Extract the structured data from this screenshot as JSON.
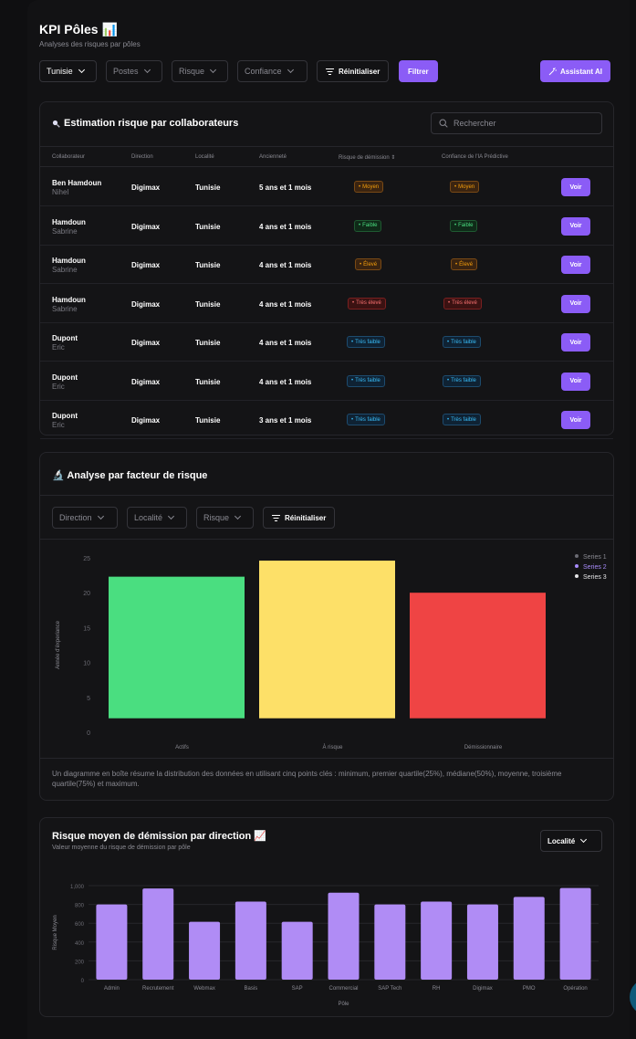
{
  "header": {
    "title": "KPI Pôles 📊",
    "subtitle": "Analyses des risques par pôles"
  },
  "filters": {
    "country": "Tunisie",
    "postes": "Postes",
    "risque": "Risque",
    "confiance": "Confiance",
    "reset": "Réinitialiser",
    "filter": "Filtrer",
    "assistant": "Assistant AI"
  },
  "estimation": {
    "title": "Estimation risque par collaborateurs",
    "search_placeholder": "Rechercher",
    "columns": [
      "Collaborateur",
      "Direction",
      "Localité",
      "Ancienneté",
      "Risque de démission ⇕",
      "Confiance de l'IA Prédictive"
    ],
    "action_label": "Voir",
    "rows": [
      {
        "last": "Ben Hamdoun",
        "first": "Nihel",
        "direction": "Digimax",
        "locality": "Tunisie",
        "seniority": "5 ans et 1 mois",
        "risk": "Moyen",
        "risk_color": "orange",
        "confidence": "Moyen",
        "confidence_color": "orange"
      },
      {
        "last": "Hamdoun",
        "first": "Sabrine",
        "direction": "Digimax",
        "locality": "Tunisie",
        "seniority": "4 ans et 1 mois",
        "risk": "Faible",
        "risk_color": "green",
        "confidence": "Faible",
        "confidence_color": "green"
      },
      {
        "last": "Hamdoun",
        "first": "Sabrine",
        "direction": "Digimax",
        "locality": "Tunisie",
        "seniority": "4 ans et 1 mois",
        "risk": "Élevé",
        "risk_color": "orange",
        "confidence": "Élevé",
        "confidence_color": "orange"
      },
      {
        "last": "Hamdoun",
        "first": "Sabrine",
        "direction": "Digimax",
        "locality": "Tunisie",
        "seniority": "4 ans et 1 mois",
        "risk": "Très élevé",
        "risk_color": "red",
        "confidence": "Très élevé",
        "confidence_color": "red"
      },
      {
        "last": "Dupont",
        "first": "Eric",
        "direction": "Digimax",
        "locality": "Tunisie",
        "seniority": "4 ans et 1 mois",
        "risk": "Très faible",
        "risk_color": "blue",
        "confidence": "Très faible",
        "confidence_color": "blue"
      },
      {
        "last": "Dupont",
        "first": "Eric",
        "direction": "Digimax",
        "locality": "Tunisie",
        "seniority": "4 ans et 1 mois",
        "risk": "Très faible",
        "risk_color": "blue",
        "confidence": "Très faible",
        "confidence_color": "blue"
      },
      {
        "last": "Dupont",
        "first": "Eric",
        "direction": "Digimax",
        "locality": "Tunisie",
        "seniority": "3 ans et 1 mois",
        "risk": "Très faible",
        "risk_color": "blue",
        "confidence": "Très faible",
        "confidence_color": "blue"
      }
    ]
  },
  "analysis": {
    "title": "🔬 Analyse par  facteur de risque",
    "filters": {
      "direction": "Direction",
      "localite": "Localité",
      "risque": "Risque",
      "reset": "Réinitialiser"
    },
    "note": "Un diagramme en boîte résume la distribution des données en utilisant cinq points clés : minimum, premier quartile(25%), médiane(50%), moyenne, troisième quartile(75%) et maximum."
  },
  "direction_risk": {
    "title": "Risque moyen de démission par direction 📈",
    "subtitle": "Valeur moyenne du risque de démission par pôle",
    "locality_button": "Localité"
  },
  "colors": {
    "accent": "#8b5cf6",
    "actifs": "#4ade80",
    "a_risque": "#fde068",
    "demissionnaire": "#ef4444",
    "bar": "#b08cf5"
  },
  "chart_data": [
    {
      "type": "bar",
      "categories": [
        "Actifs",
        "À risque",
        "Démissionnaire"
      ],
      "values": [
        22.3,
        24.6,
        20
      ],
      "baseline": 2,
      "bar_colors": [
        "#4ade80",
        "#fde068",
        "#ef4444"
      ],
      "ylabel": "Année d'éxperiance",
      "ylim": [
        0,
        25
      ],
      "yticks": [
        0,
        5,
        10,
        15,
        20,
        25
      ],
      "legend": [
        {
          "name": "Series 1",
          "color": "#6b6b73"
        },
        {
          "name": "Series 2",
          "color": "#a78bfa"
        },
        {
          "name": "Series 3",
          "color": "#e5e5e7"
        }
      ],
      "legend_position": "top-right",
      "grid": false
    },
    {
      "type": "bar",
      "categories": [
        "Admin",
        "Recrutement",
        "Webmax",
        "Basis",
        "SAP",
        "Commercial",
        "SAP Tech",
        "RH",
        "Digimax",
        "PMO",
        "Opération"
      ],
      "values": [
        800,
        970,
        615,
        830,
        615,
        925,
        800,
        830,
        800,
        880,
        975
      ],
      "xlabel": "Pôle",
      "ylabel": "Risque Moyen",
      "ylim": [
        0,
        1000
      ],
      "yticks": [
        "0",
        "200",
        "400",
        "600",
        "800",
        "1,000"
      ],
      "grid": true
    }
  ]
}
